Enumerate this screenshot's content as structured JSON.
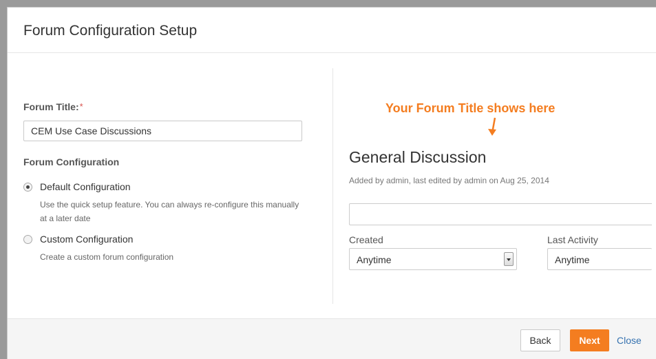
{
  "modal": {
    "title": "Forum Configuration Setup"
  },
  "form": {
    "title_label": "Forum Title:",
    "required_marker": "*",
    "title_value": "CEM Use Case Discussions",
    "config_heading": "Forum Configuration",
    "options": [
      {
        "label": "Default Configuration",
        "description": "Use the quick setup feature. You can always re-configure this manually at a later date",
        "checked": true
      },
      {
        "label": "Custom Configuration",
        "description": "Create a custom forum configuration",
        "checked": false
      }
    ]
  },
  "preview": {
    "annotation": "Your Forum Title shows here",
    "annotation_color": "#f47d20",
    "discussion_title": "General Discussion",
    "meta": "Added by admin, last edited by admin on Aug 25, 2014",
    "search_value": "",
    "filters": [
      {
        "label": "Created",
        "value": "Anytime"
      },
      {
        "label": "Last Activity",
        "value": "Anytime"
      }
    ]
  },
  "footer": {
    "back_label": "Back",
    "next_label": "Next",
    "close_label": "Close",
    "accent_color": "#f47d20",
    "link_color": "#3572b0"
  }
}
